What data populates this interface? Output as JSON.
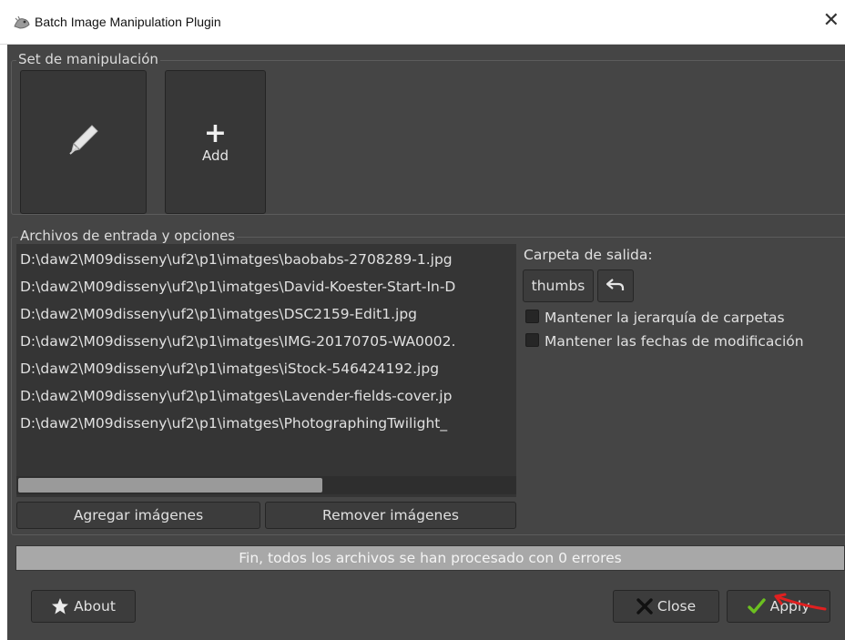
{
  "window": {
    "title": "Batch Image Manipulation Plugin",
    "close_glyph": "✕"
  },
  "manipulation_set": {
    "label": "Set de manipulación",
    "tiles": [
      {
        "icon": "pen-nib-icon"
      },
      {
        "icon": "plus-icon",
        "plus_glyph": "+",
        "label": "Add"
      }
    ]
  },
  "input_files": {
    "label": "Archivos de entrada y opciones",
    "items": [
      "D:\\daw2\\M09disseny\\uf2\\p1\\imatges\\baobabs-2708289-1.jpg",
      "D:\\daw2\\M09disseny\\uf2\\p1\\imatges\\David-Koester-Start-In-D",
      "D:\\daw2\\M09disseny\\uf2\\p1\\imatges\\DSC2159-Edit1.jpg",
      "D:\\daw2\\M09disseny\\uf2\\p1\\imatges\\IMG-20170705-WA0002.",
      "D:\\daw2\\M09disseny\\uf2\\p1\\imatges\\iStock-546424192.jpg",
      "D:\\daw2\\M09disseny\\uf2\\p1\\imatges\\Lavender-fields-cover.jp",
      "D:\\daw2\\M09disseny\\uf2\\p1\\imatges\\PhotographingTwilight_"
    ],
    "add_button": "Agregar imágenes",
    "remove_button": "Remover imágenes"
  },
  "output": {
    "label": "Carpeta de salida:",
    "folder_button": "thumbs",
    "reset_icon": "undo-arrow-icon",
    "checkbox_keep_hierarchy": "Mantener la jerarquía de carpetas",
    "checkbox_keep_dates": "Mantener las fechas de modificación",
    "keep_hierarchy_checked": false,
    "keep_dates_checked": false
  },
  "progress": {
    "text": "Fin, todos los archivos se han procesado con 0 errores",
    "fraction": 1.0
  },
  "footer": {
    "about_label": "About",
    "close_label": "Close",
    "apply_label": "Apply"
  },
  "colors": {
    "background": "#454545",
    "list_background": "#353535",
    "apply_check": "#6cc020",
    "close_x": "#111111",
    "annotation_arrow": "#e02020"
  }
}
